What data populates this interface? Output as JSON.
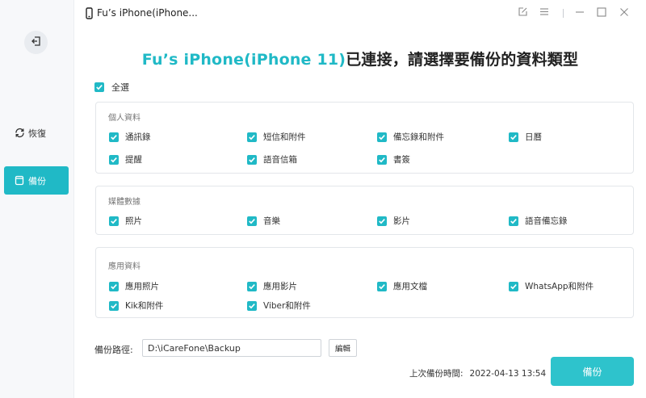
{
  "window": {
    "title": "Fu’s iPhone(iPhone..."
  },
  "sidebar": {
    "items": [
      {
        "label": "恢復",
        "icon": "restore-icon"
      },
      {
        "label": "備份",
        "icon": "backup-icon",
        "active": true
      }
    ]
  },
  "headline": {
    "device": "Fu’s iPhone(iPhone 11)",
    "text": "已連接，請選擇要備份的資料類型"
  },
  "select_all": {
    "label": "全選",
    "checked": true
  },
  "groups": [
    {
      "title": "個人資料",
      "options": [
        "通訊錄",
        "短信和附件",
        "備忘錄和附件",
        "日曆",
        "提醒",
        "語音信箱",
        "書簽"
      ]
    },
    {
      "title": "媒體數據",
      "options": [
        "照片",
        "音樂",
        "影片",
        "語音備忘錄"
      ]
    },
    {
      "title": "應用資料",
      "options": [
        "應用照片",
        "應用影片",
        "應用文檔",
        "WhatsApp和附件",
        "Kik和附件",
        "Viber和附件"
      ]
    }
  ],
  "backup_path": {
    "label": "備份路徑:",
    "value": "D:\\iCareFone\\Backup",
    "edit_label": "編輯"
  },
  "last_backup": {
    "label": "上次備份時間:",
    "time": "2022-04-13 13:54"
  },
  "backup_button": {
    "label": "備份"
  },
  "colors": {
    "accent": "#20b9c6",
    "button": "#2ec3cc",
    "checkbox": "#20b9c6"
  }
}
